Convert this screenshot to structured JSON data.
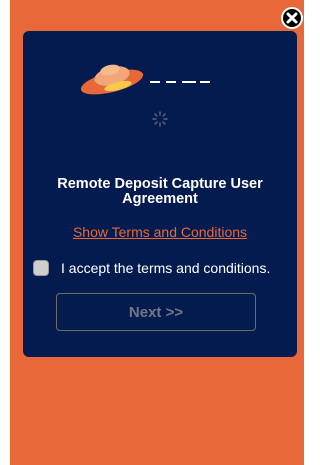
{
  "modal": {
    "title": "Remote Deposit Capture User Agreement",
    "terms_link": "Show Terms and Conditions",
    "accept_label": "I accept the terms and conditions.",
    "accept_checked": false,
    "next_label": "Next >>",
    "next_enabled": false
  },
  "icons": {
    "close": "close-icon",
    "logo": "ufo-logo",
    "spinner": "loading-spinner-icon"
  },
  "colors": {
    "background": "#e8683a",
    "modal": "#031b4e",
    "link": "#e8683a",
    "text": "#ffffff",
    "disabled_button_text": "#6f7a86"
  }
}
